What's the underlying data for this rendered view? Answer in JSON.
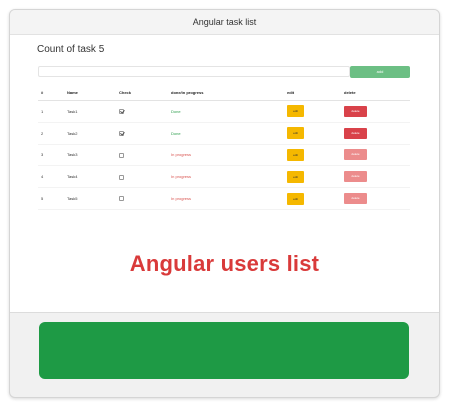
{
  "window": {
    "title": "Angular task list"
  },
  "count_label": "Count of task 5",
  "add_button_label": "add",
  "add_input_value": "",
  "table": {
    "headers": [
      "#",
      "Name",
      "Check",
      "done/in progress",
      "edit",
      "delete"
    ],
    "rows": [
      {
        "num": "1",
        "name": "Task1",
        "checked": true,
        "status": "Done",
        "edit": "edit",
        "delete": "delete"
      },
      {
        "num": "2",
        "name": "Task2",
        "checked": true,
        "status": "Done",
        "edit": "edit",
        "delete": "delete"
      },
      {
        "num": "3",
        "name": "Task3",
        "checked": false,
        "status": "In progress",
        "edit": "edit",
        "delete": "delete"
      },
      {
        "num": "4",
        "name": "Task4",
        "checked": false,
        "status": "In progress",
        "edit": "edit",
        "delete": "delete"
      },
      {
        "num": "5",
        "name": "Task5",
        "checked": false,
        "status": "In progress",
        "edit": "edit",
        "delete": "delete"
      }
    ]
  },
  "overlay_caption": "Angular users list",
  "colors": {
    "done": "#2e9e4d",
    "in_progress": "#d9534f",
    "edit": "#f5b800",
    "delete_done": "#d9424a",
    "delete_progress": "#ec8c8c",
    "add_button": "#6cbf84",
    "green_block": "#1e9a45",
    "caption": "#d93a3a"
  }
}
